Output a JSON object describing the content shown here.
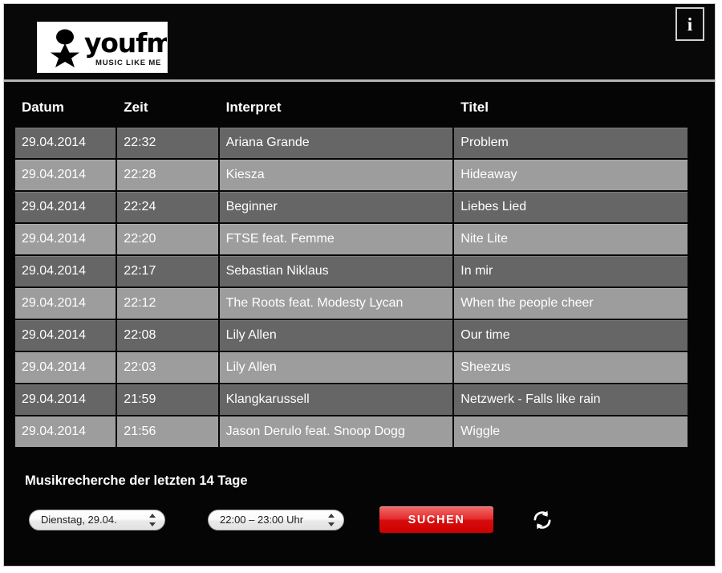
{
  "station": {
    "logo_word": "youfm",
    "logo_tagline": "MUSIC LIKE ME"
  },
  "header": {
    "info_label": "i"
  },
  "table": {
    "headers": {
      "datum": "Datum",
      "zeit": "Zeit",
      "interpret": "Interpret",
      "titel": "Titel"
    },
    "rows": [
      {
        "datum": "29.04.2014",
        "zeit": "22:32",
        "interpret": "Ariana Grande",
        "titel": "Problem"
      },
      {
        "datum": "29.04.2014",
        "zeit": "22:28",
        "interpret": "Kiesza",
        "titel": "Hideaway"
      },
      {
        "datum": "29.04.2014",
        "zeit": "22:24",
        "interpret": "Beginner",
        "titel": "Liebes Lied"
      },
      {
        "datum": "29.04.2014",
        "zeit": "22:20",
        "interpret": "FTSE feat. Femme",
        "titel": "Nite Lite"
      },
      {
        "datum": "29.04.2014",
        "zeit": "22:17",
        "interpret": "Sebastian Niklaus",
        "titel": "In mir"
      },
      {
        "datum": "29.04.2014",
        "zeit": "22:12",
        "interpret": "The Roots feat. Modesty Lycan",
        "titel": "When the people cheer"
      },
      {
        "datum": "29.04.2014",
        "zeit": "22:08",
        "interpret": "Lily Allen",
        "titel": "Our time"
      },
      {
        "datum": "29.04.2014",
        "zeit": "22:03",
        "interpret": "Lily Allen",
        "titel": "Sheezus"
      },
      {
        "datum": "29.04.2014",
        "zeit": "21:59",
        "interpret": "Klangkarussell",
        "titel": "Netzwerk - Falls like rain"
      },
      {
        "datum": "29.04.2014",
        "zeit": "21:56",
        "interpret": "Jason Derulo feat. Snoop Dogg",
        "titel": "Wiggle"
      }
    ]
  },
  "search": {
    "heading": "Musikrecherche der letzten 14 Tage",
    "day_value": "Dienstag, 29.04.",
    "time_value": "22:00 – 23:00 Uhr",
    "submit_label": "SUCHEN"
  },
  "colors": {
    "background": "#050505",
    "row_dark": "#666666",
    "row_light": "#9d9d9d",
    "accent_red": "#d60d0d",
    "text": "#ffffff"
  }
}
